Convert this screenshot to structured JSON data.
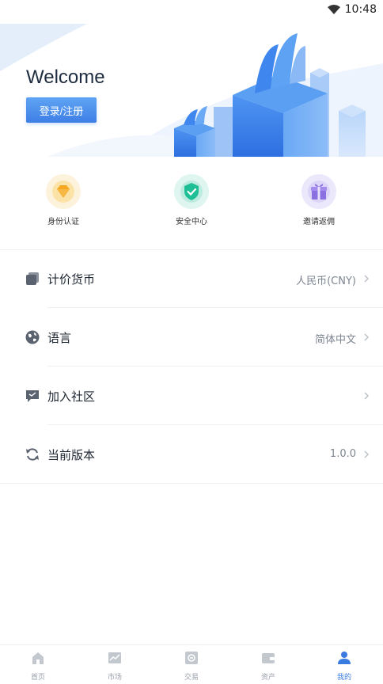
{
  "status_bar": {
    "time": "10:48"
  },
  "hero": {
    "welcome": "Welcome",
    "login_label": "登录/注册"
  },
  "quick_actions": [
    {
      "label": "身份认证",
      "icon": "diamond-icon"
    },
    {
      "label": "安全中心",
      "icon": "shield-check-icon"
    },
    {
      "label": "邀请返佣",
      "icon": "gift-icon"
    }
  ],
  "settings": [
    {
      "label": "计价货币",
      "value": "人民币(CNY)",
      "icon": "currency-icon"
    },
    {
      "label": "语言",
      "value": "简体中文",
      "icon": "globe-icon"
    },
    {
      "label": "加入社区",
      "value": "",
      "icon": "chat-icon"
    },
    {
      "label": "当前版本",
      "value": "1.0.0",
      "icon": "refresh-icon"
    }
  ],
  "bottom_nav": [
    {
      "label": "首页",
      "icon": "home-icon"
    },
    {
      "label": "市场",
      "icon": "chart-icon"
    },
    {
      "label": "交易",
      "icon": "exchange-icon"
    },
    {
      "label": "资产",
      "icon": "wallet-icon"
    },
    {
      "label": "我的",
      "icon": "user-icon",
      "active": true
    }
  ],
  "colors": {
    "accent": "#3a7be0",
    "text": "#1f2733",
    "muted": "#7d8590"
  }
}
